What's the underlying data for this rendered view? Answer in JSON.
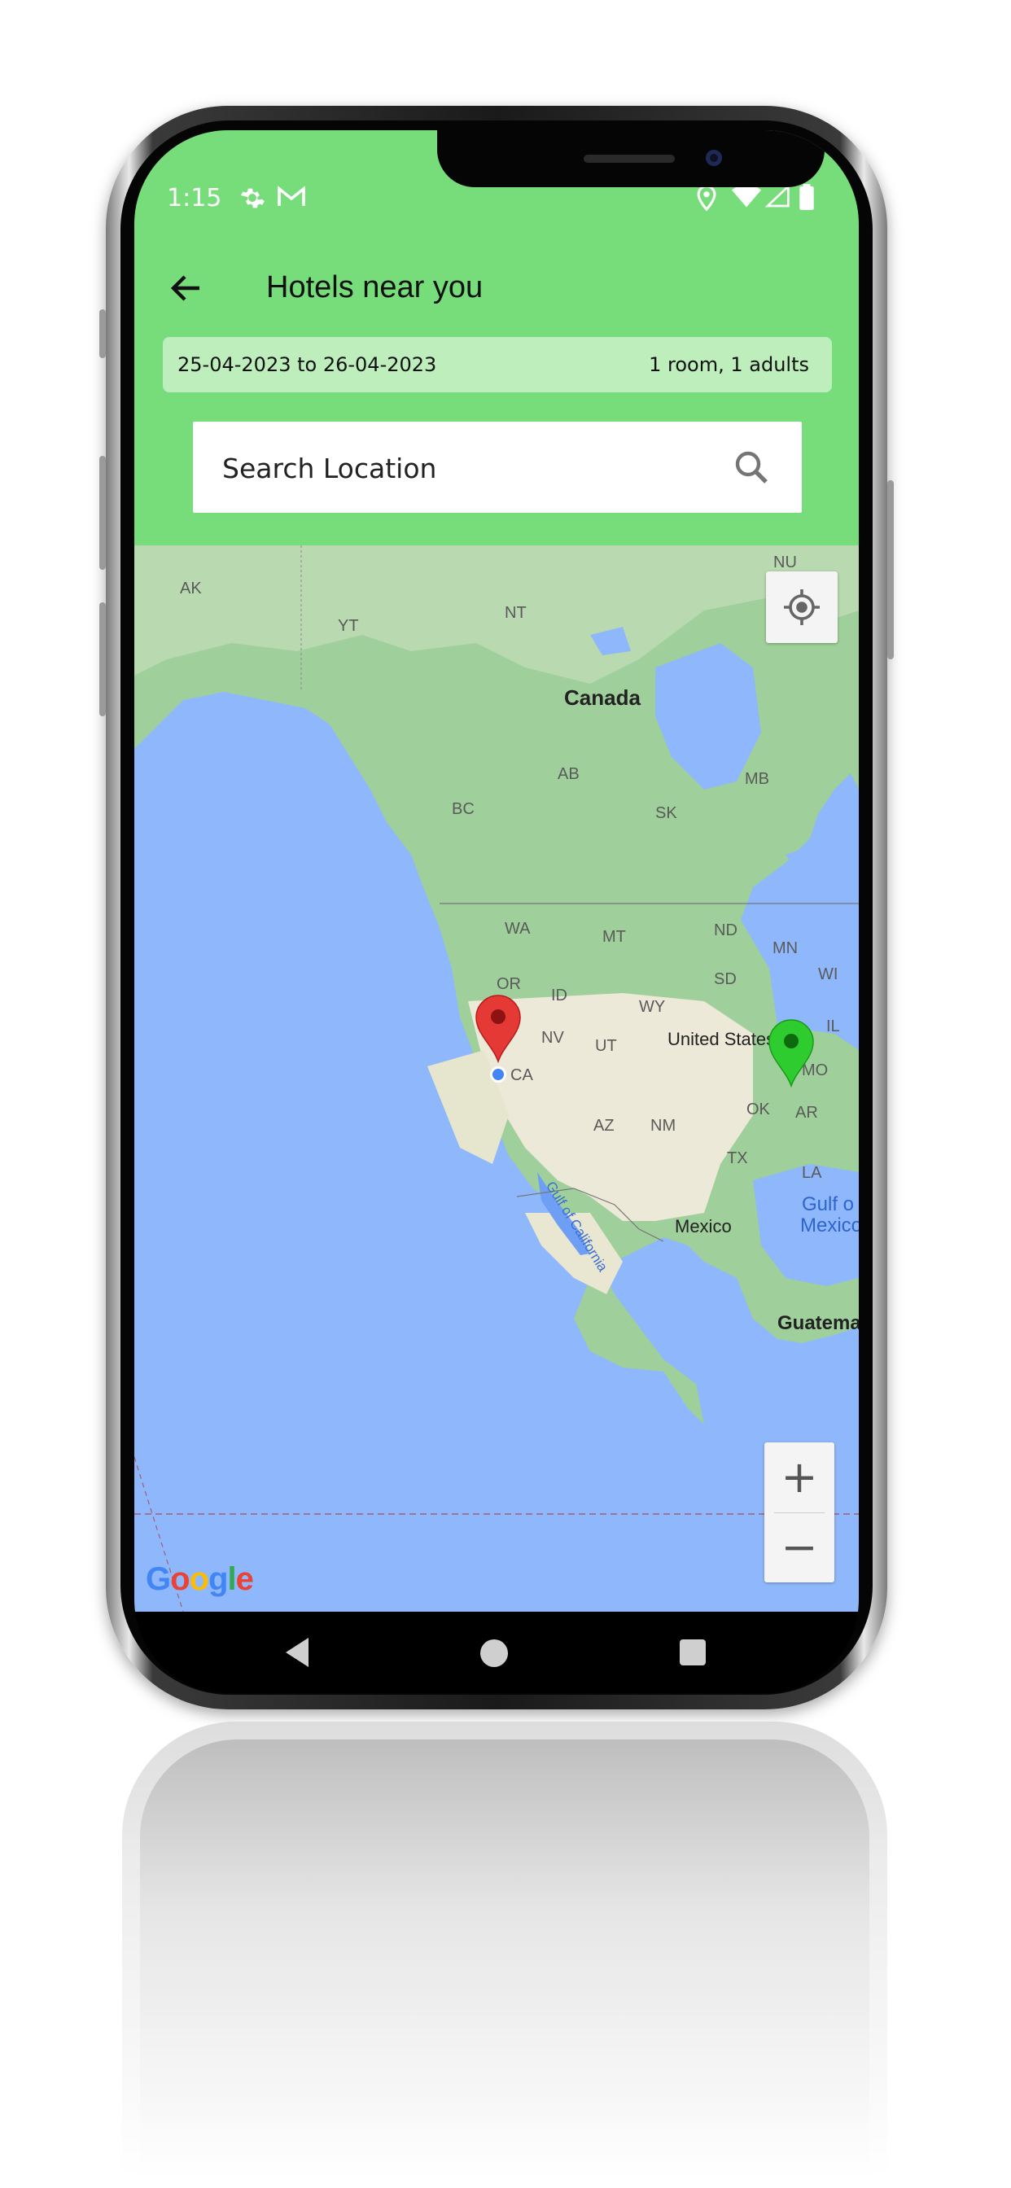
{
  "status_bar": {
    "time": "1:15",
    "icons": [
      "settings-icon",
      "gmail-icon",
      "location-icon",
      "wifi-icon",
      "signal-icon",
      "battery-icon"
    ]
  },
  "app_bar": {
    "title": "Hotels near you",
    "back_icon": "arrow-back-icon"
  },
  "booking_bar": {
    "dates": "25-04-2023 to 26-04-2023",
    "rooms": "1 room, 1 adults"
  },
  "search": {
    "placeholder": "Search Location",
    "icon": "search-icon"
  },
  "map": {
    "labels": {
      "canada": "Canada",
      "united_states": "United States",
      "mexico": "Mexico",
      "guatemala": "Guatema",
      "gulf_mexico_1": "Gulf o",
      "gulf_mexico_2": "Mexico",
      "gulf_california": "Gulf of California",
      "ak": "AK",
      "yt": "YT",
      "nt": "NT",
      "nu": "NU",
      "bc": "BC",
      "ab": "AB",
      "sk": "SK",
      "mb": "MB",
      "wa": "WA",
      "or": "OR",
      "id": "ID",
      "mt": "MT",
      "nd": "ND",
      "mn": "MN",
      "sd": "SD",
      "wy": "WY",
      "wi": "WI",
      "nv": "NV",
      "ut": "UT",
      "ca": "CA",
      "il": "IL",
      "mo": "MO",
      "az": "AZ",
      "nm": "NM",
      "ok": "OK",
      "ar": "AR",
      "tx": "TX",
      "la": "LA"
    },
    "markers": [
      {
        "name": "hotel-marker-red",
        "color": "#e53935"
      },
      {
        "name": "hotel-marker-green",
        "color": "#2ecc2e"
      }
    ],
    "zoom_in": "+",
    "zoom_out": "−",
    "attribution": "Google"
  },
  "colors": {
    "header_green": "#77dc7a",
    "datebar_green": "#bdeebc",
    "water": "#8fb7fb"
  }
}
